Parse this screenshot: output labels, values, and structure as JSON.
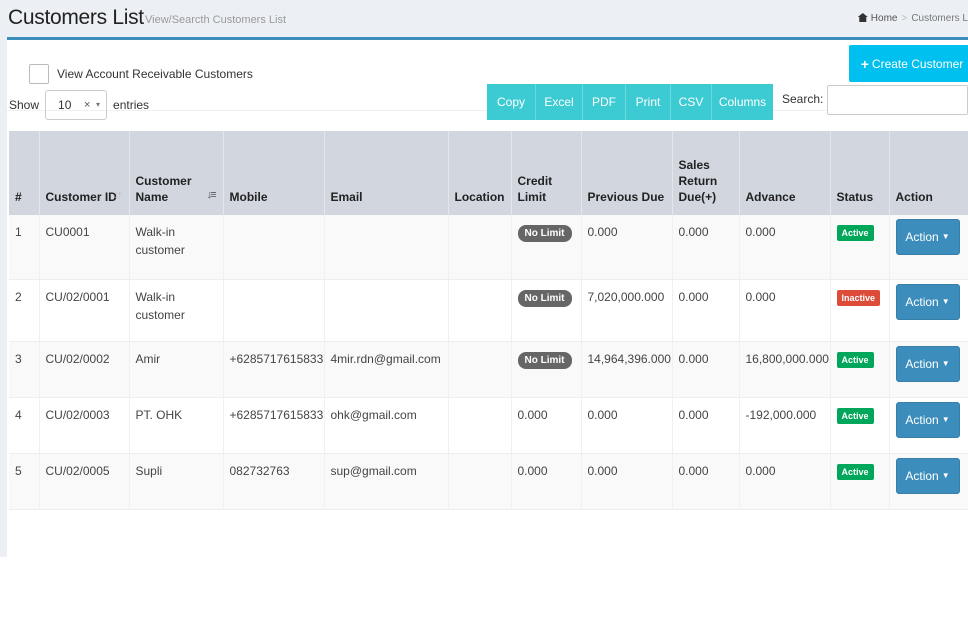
{
  "header": {
    "title": "Customers List",
    "subtitle": "View/Searcth Customers List",
    "breadcrumb_home": "Home",
    "breadcrumb_current": "Customers L",
    "breadcrumb_sep": ">"
  },
  "filter": {
    "receivable_label": "View Account Receivable Customers"
  },
  "create_button": {
    "icon": "plus-icon",
    "label": "Create Customer"
  },
  "length_control": {
    "show_label": "Show",
    "value": "10",
    "clear": "×",
    "caret": "▾",
    "entries_label": "entries"
  },
  "export_buttons": [
    "Copy",
    "Excel",
    "PDF",
    "Print",
    "CSV",
    "Columns"
  ],
  "search": {
    "label": "Search:",
    "value": ""
  },
  "table": {
    "columns": [
      "#",
      "Customer ID",
      "Customer Name",
      "Mobile",
      "Email",
      "Location",
      "Credit Limit",
      "Previous Due",
      "Sales Return Due(+)",
      "Advance",
      "Status",
      "Action"
    ],
    "rows": [
      {
        "no": "1",
        "id": "CU0001",
        "name": "Walk-in customer",
        "mobile": "",
        "email": "",
        "location": "",
        "credit": "No Limit",
        "credit_badge": true,
        "prev_due": "0.000",
        "return_due": "0.000",
        "advance": "0.000",
        "status": "Active",
        "action": "Action"
      },
      {
        "no": "2",
        "id": "CU/02/0001",
        "name": "Walk-in customer",
        "mobile": "",
        "email": "",
        "location": "",
        "credit": "No Limit",
        "credit_badge": true,
        "prev_due": "7,020,000.000",
        "return_due": "0.000",
        "advance": "0.000",
        "status": "Inactive",
        "action": "Action"
      },
      {
        "no": "3",
        "id": "CU/02/0002",
        "name": "Amir",
        "mobile": "+6285717615833",
        "email": "4mir.rdn@gmail.com",
        "location": "",
        "credit": "No Limit",
        "credit_badge": true,
        "prev_due": "14,964,396.000",
        "return_due": "0.000",
        "advance": "16,800,000.000",
        "status": "Active",
        "action": "Action"
      },
      {
        "no": "4",
        "id": "CU/02/0003",
        "name": "PT. OHK",
        "mobile": "+6285717615833",
        "email": "ohk@gmail.com",
        "location": "",
        "credit": "0.000",
        "credit_badge": false,
        "prev_due": "0.000",
        "return_due": "0.000",
        "advance": "-192,000.000",
        "status": "Active",
        "action": "Action"
      },
      {
        "no": "5",
        "id": "CU/02/0005",
        "name": "Supli",
        "mobile": "082732763",
        "email": "sup@gmail.com",
        "location": "",
        "credit": "0.000",
        "credit_badge": false,
        "prev_due": "0.000",
        "return_due": "0.000",
        "advance": "0.000",
        "status": "Active",
        "action": "Action"
      }
    ]
  },
  "colors": {
    "primary": "#3c8dbc",
    "create": "#00c0ef",
    "export": "#3ccbd2",
    "active": "#00a65a",
    "inactive": "#dd4b39",
    "nolimit": "#666666"
  }
}
